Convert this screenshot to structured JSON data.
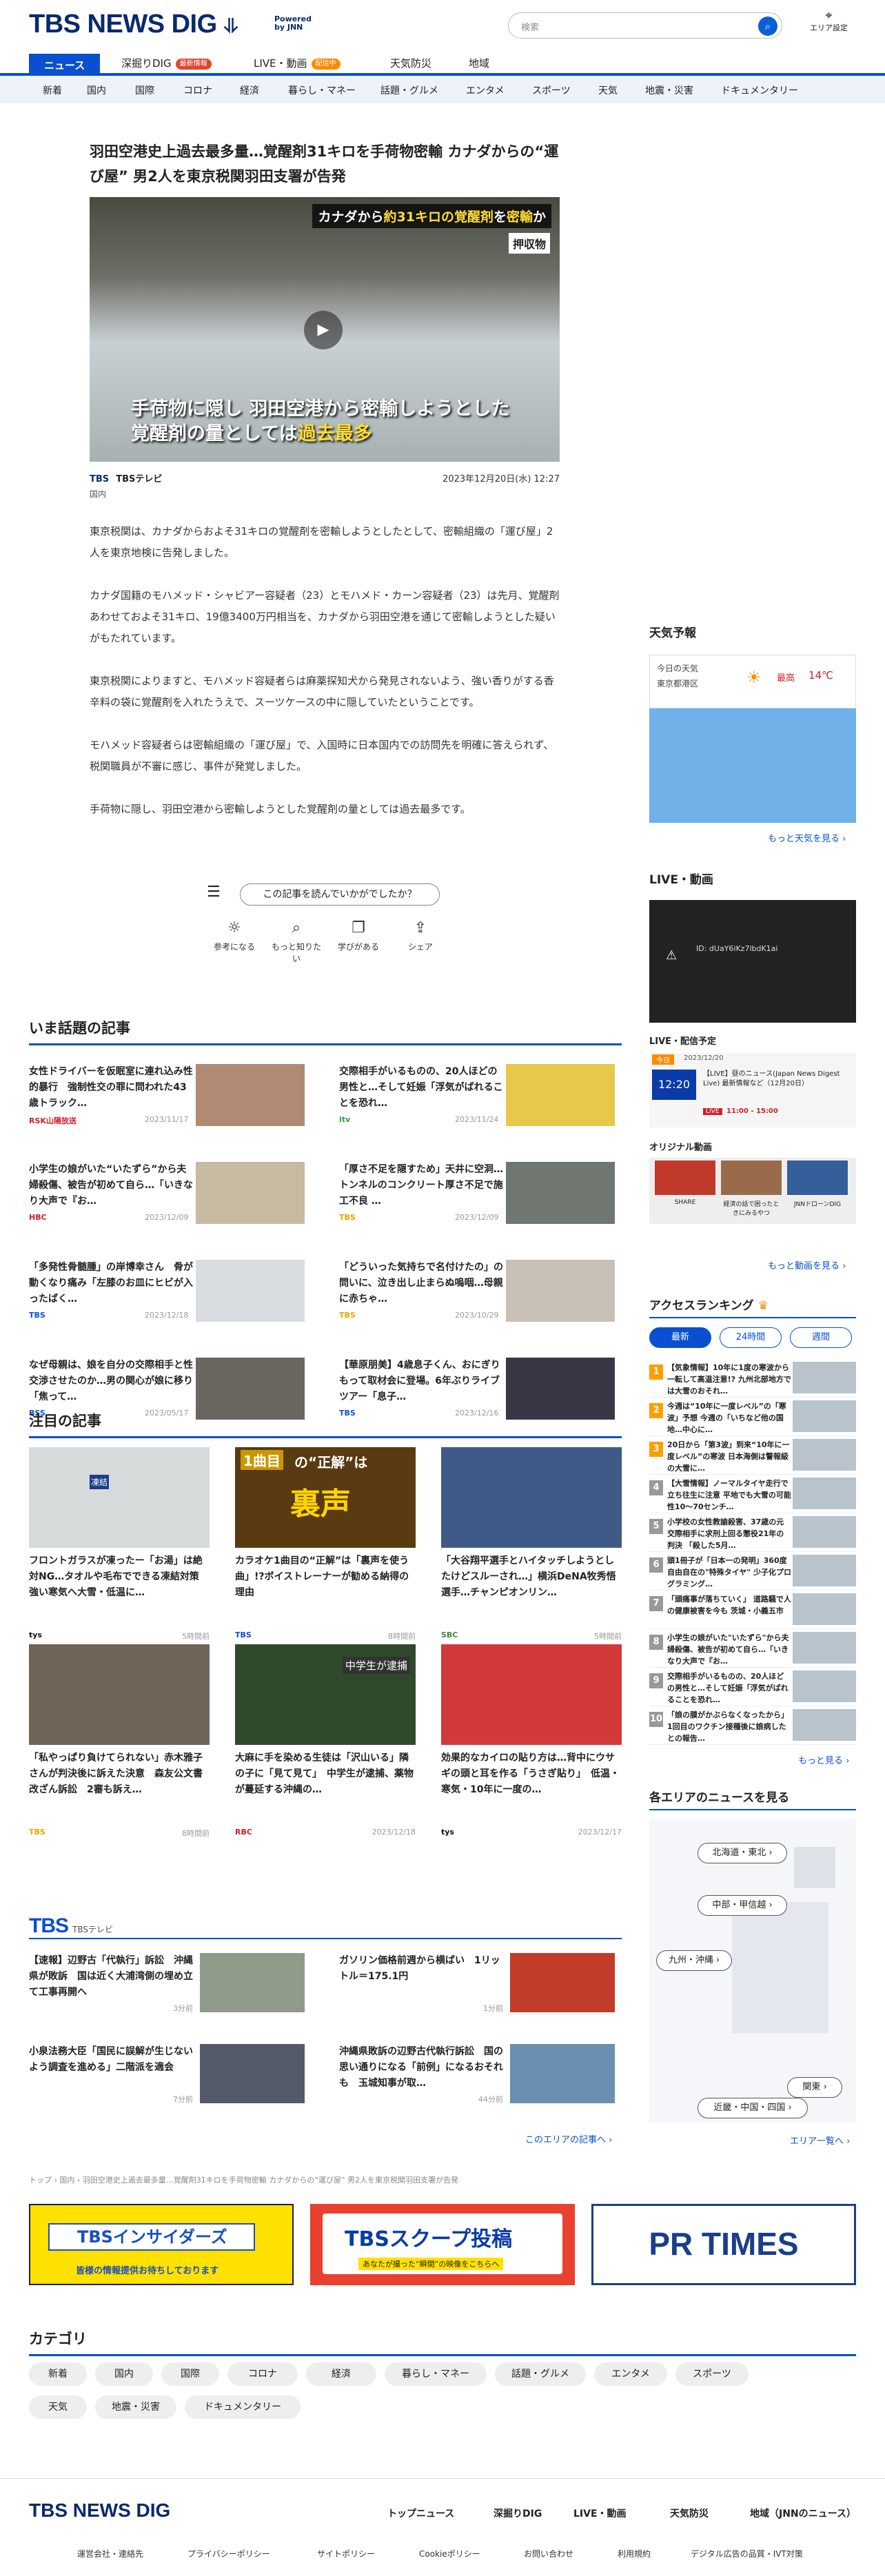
{
  "header": {
    "logo": "TBS NEWS DIG",
    "powered": "Powered",
    "by": "by JNN",
    "search_placeholder": "検索",
    "area_label": "エリア設定"
  },
  "nav_main": [
    {
      "label": "ニュース",
      "active": true
    },
    {
      "label": "深掘りDIG",
      "badge": "最新情報"
    },
    {
      "label": "LIVE・動画",
      "badge": "配信中"
    },
    {
      "label": "天気防災"
    },
    {
      "label": "地域"
    }
  ],
  "nav_sub": [
    "新着",
    "国内",
    "国際",
    "コロナ",
    "経済",
    "暮らし・マネー",
    "話題・グルメ",
    "エンタメ",
    "スポーツ",
    "天気",
    "地震・災害",
    "ドキュメンタリー"
  ],
  "article": {
    "title": "羽田空港史上過去最多量…覚醒剤31キロを手荷物密輸 カナダからの“運び屋” 男2人を東京税関羽田支署が告発",
    "video_band_a": "カナダから",
    "video_band_b": "約31キロの覚醒剤",
    "video_band_c": "を",
    "video_band_d": "密輸",
    "video_band_e": "か",
    "video_tag": "押収物",
    "video_cap_1": "手荷物に隠し 羽田空港から密輸しようとした",
    "video_cap_2a": "覚醒剤の量としては",
    "video_cap_2b": "過去最多",
    "source_logo": "TBS",
    "source": "TBSテレビ",
    "date": "2023年12月20日(水) 12:27",
    "category": "国内",
    "paragraphs": [
      "東京税関は、カナダからおよそ31キロの覚醒剤を密輸しようとしたとして、密輸組織の「運び屋」2人を東京地検に告発しました。",
      "カナダ国籍のモハメッド・シャビアー容疑者（23）とモハメド・カーン容疑者（23）は先月、覚醒剤あわせておよそ31キロ、19億3400万円相当を、カナダから羽田空港を通じて密輸しようとした疑いがもたれています。",
      "東京税関によりますと、モハメッド容疑者らは麻薬探知犬から発見されないよう、強い香りがする香辛料の袋に覚醒剤を入れたうえで、スーツケースの中に隠していたということです。",
      "モハメッド容疑者らは密輸組織の「運び屋」で、入国時に日本国内での訪問先を明確に答えられず、税関職員が不審に感じ、事件が発覚しました。",
      "手荷物に隠し、羽田空港から密輸しようとした覚醒剤の量としては過去最多です。"
    ],
    "reaction_q": "この記事を読んでいかがでしたか？",
    "reactions": [
      "参考になる",
      "もっと知りたい",
      "学びがある",
      "シェア"
    ]
  },
  "trending": {
    "title": "いま話題の記事",
    "items": [
      {
        "t": "女性ドライバーを仮眠室に連れ込み性的暴行　強制性交の罪に問われた43歳トラック…",
        "s": "RSK山陽放送",
        "d": "2023/11/17"
      },
      {
        "t": "交際相手がいるものの、20人ほどの男性と…そして妊娠「浮気がばれることを恐れ…",
        "s": "itv",
        "d": "2023/11/24"
      },
      {
        "t": "小学生の娘がいた“いたずら”から夫婦殺傷、被告が初めて自ら…「いきなり大声で『お…",
        "s": "HBC",
        "d": "2023/12/09"
      },
      {
        "t": "「厚さ不足を隠すため」天井に空洞…トンネルのコンクリート厚さ不足で施工不良 …",
        "s": "TBS",
        "d": "2023/12/09"
      },
      {
        "t": "「多発性骨髄腫」の岸博幸さん　骨が動くなり痛み「左膝のお皿にヒビが入ったばく…",
        "s": "TBS",
        "d": "2023/12/18"
      },
      {
        "t": "「どういった気持ちで名付けたの」の問いに、泣き出し止まらぬ嗚咽…母親に赤ちゃ…",
        "s": "TBS",
        "d": "2023/10/29"
      },
      {
        "t": "なぜ母親は、娘を自分の交際相手と性交渉させたのか…男の関心が娘に移り「焦って…",
        "s": "BSS",
        "d": "2023/05/17"
      },
      {
        "t": "【華原朋美】4歳息子くん、おにぎりもって取材会に登場。6年ぶりライブツアー「息子…",
        "s": "TBS",
        "d": "2023/12/16"
      }
    ]
  },
  "featured": {
    "title": "注目の記事",
    "items": [
      {
        "t": "フロントガラスが凍ったー「お湯」は絶対NG…タオルや毛布でできる凍結対策 強い寒気へ大雪・低温に…",
        "s": "tys",
        "d": "5時間前"
      },
      {
        "t": "カラオケ1曲目の“正解”は「裏声を使う曲」!?ボイストレーナーが勧める納得の理由",
        "s": "TBS",
        "d": "8時間前"
      },
      {
        "t": "「大谷翔平選手とハイタッチしようとしたけどスルーされ…」横浜DeNA牧秀悟選手…チャンピオンリン…",
        "s": "SBC",
        "d": "5時間前"
      },
      {
        "t": "「私やっぱり負けてられない」赤木雅子さんが判決後に訴えた決意　森友公文書改ざん訴訟　2審も訴え…",
        "s": "TBS",
        "d": "8時間前"
      },
      {
        "t": "大麻に手を染める生徒は「沢山いる」隣の子に「見て見て」　中学生が逮捕、薬物が蔓延する沖縄の…",
        "s": "RBC",
        "d": "2023/12/18"
      },
      {
        "t": "効果的なカイロの貼り方は…背中にウサギの頭と耳を作る「うさぎ貼り」　低温・寒気・10年に一度の…",
        "s": "tys",
        "d": "2023/12/17"
      }
    ],
    "img_texts": {
      "a": "凍結",
      "b1": "1曲目",
      "b2": "の“正解”は",
      "b3": "裏声",
      "c": "中学生が逮捕"
    }
  },
  "tbs_block": {
    "logo": "TBS",
    "sub": "TBSテレビ",
    "items": [
      {
        "t": "【速報】辺野古「代執行」訴訟　沖縄県が敗訴　国は近く大浦湾側の埋め立て工事再開へ",
        "d": "3分前"
      },
      {
        "t": "ガソリン価格前週から横ばい　1リットル＝175.1円",
        "d": "1分前"
      },
      {
        "t": "小泉法務大臣「国民に誤解が生じないよう調査を進める」二階派を適会",
        "d": "7分前"
      },
      {
        "t": "沖縄県敗訴の辺野古代執行訴訟　国の思い通りになる「前例」になるおそれも　玉城知事が取…",
        "d": "44分前"
      }
    ],
    "more": "このエリアの記事へ ›"
  },
  "breadcrumb": "トップ › 国内 › 羽田空港史上過去最多量…覚醒剤31キロを手荷物密輸 カナダからの“運び屋” 男2人を東京税関羽田支署が告発",
  "banners": {
    "insiders": "TBSインサイダーズ",
    "insiders_sub": "皆様の情報提供お待ちしております",
    "scoop": "TBSスクープ投稿",
    "scoop_sub": "あなたが撮った“瞬間”の映像をこちらへ",
    "prtimes": "PR TIMES"
  },
  "categories": {
    "title": "カテゴリ",
    "items": [
      "新着",
      "国内",
      "国際",
      "コロナ",
      "経済",
      "暮らし・マネー",
      "話題・グルメ",
      "エンタメ",
      "スポーツ",
      "天気",
      "地震・災害",
      "ドキュメンタリー"
    ]
  },
  "footer": {
    "logo": "TBS NEWS DIG",
    "links": [
      "トップニュース",
      "深掘りDIG",
      "LIVE・動画",
      "天気防災",
      "地域（JNNのニュース）"
    ],
    "sub": [
      "運営会社・連絡先",
      "プライバシーポリシー",
      "サイトポリシー",
      "Cookieポリシー",
      "お問い合わせ",
      "利用規約",
      "デジタル広告の品質・IVT対策"
    ]
  },
  "sidebar": {
    "weather": {
      "title": "天気予報",
      "today": "今日の天気",
      "place": "東京都港区",
      "hi_label": "最高",
      "hi": "14℃",
      "more": "もっと天気を見る ›"
    },
    "live": {
      "title": "LIVE・動画",
      "error": "ID: dUaY6iKz7lbdK1ai",
      "sched_title": "LIVE・配信予定",
      "sched_today": "今日",
      "sched_date": "2023/12/20",
      "sched_time": "12:20",
      "sched_t": "【LIVE】昼のニュース(Japan News Digest Live) 最新情報など（12月20日）",
      "sched_live": "LIVE",
      "sched_range": "11:00 - 15:00"
    },
    "original": {
      "title": "オリジナル動画",
      "items": [
        "SHARE",
        "経済の話で困ったときにみるやつ",
        "JNNドローンDIG"
      ],
      "more": "もっと動画を見る ›"
    },
    "ranking": {
      "title": "アクセスランキング",
      "tabs": [
        "最新",
        "24時間",
        "週間"
      ],
      "items": [
        "【気象情報】10年に1度の寒波から一転して高温注意!? 九州北部地方では大雪のおそれ…",
        "今週は“10年に一度レベル”の「寒波」予想 今週の「いちなど他の国地…中心に…",
        "20日から「第3波」到来“10年に一度レベル”の寒波 日本海側は警報級の大雪に…",
        "【大雪情報】ノーマルタイヤ走行で立ち往生に注意 平地でも大雪の可能性10〜70センチ…",
        "小学校の女性教諭殺害、37歳の元交際相手に求刑上回る懲役21年の判決 「殺した5月…",
        "頭1冊子が「日本一の発明」360度自由自在の\"特殊タイヤ\" 少子化プログラミング…",
        "「頭痛事が落ちていく」 道路騒で人の健康被害を今も 茨城・小義五市",
        "小学生の娘がいた\"いたずら\"から夫婦殺傷、被告が初めて自ら…「いきなり大声で『お…",
        "交際相手がいるものの、20人ほどの男性と…そして妊娠「浮気がばれることを恐れ…",
        "「娘の膜がかぶらなくなったから」1回目のワクチン接種後に娘病したとの報告…"
      ],
      "more": "もっと見る ›"
    },
    "areas": {
      "title": "各エリアのニュースを見る",
      "items": [
        "北海道・東北 ›",
        "中部・甲信越 ›",
        "九州・沖縄 ›",
        "関東 ›",
        "近畿・中国・四国 ›"
      ],
      "more": "エリア一覧へ ›"
    }
  }
}
